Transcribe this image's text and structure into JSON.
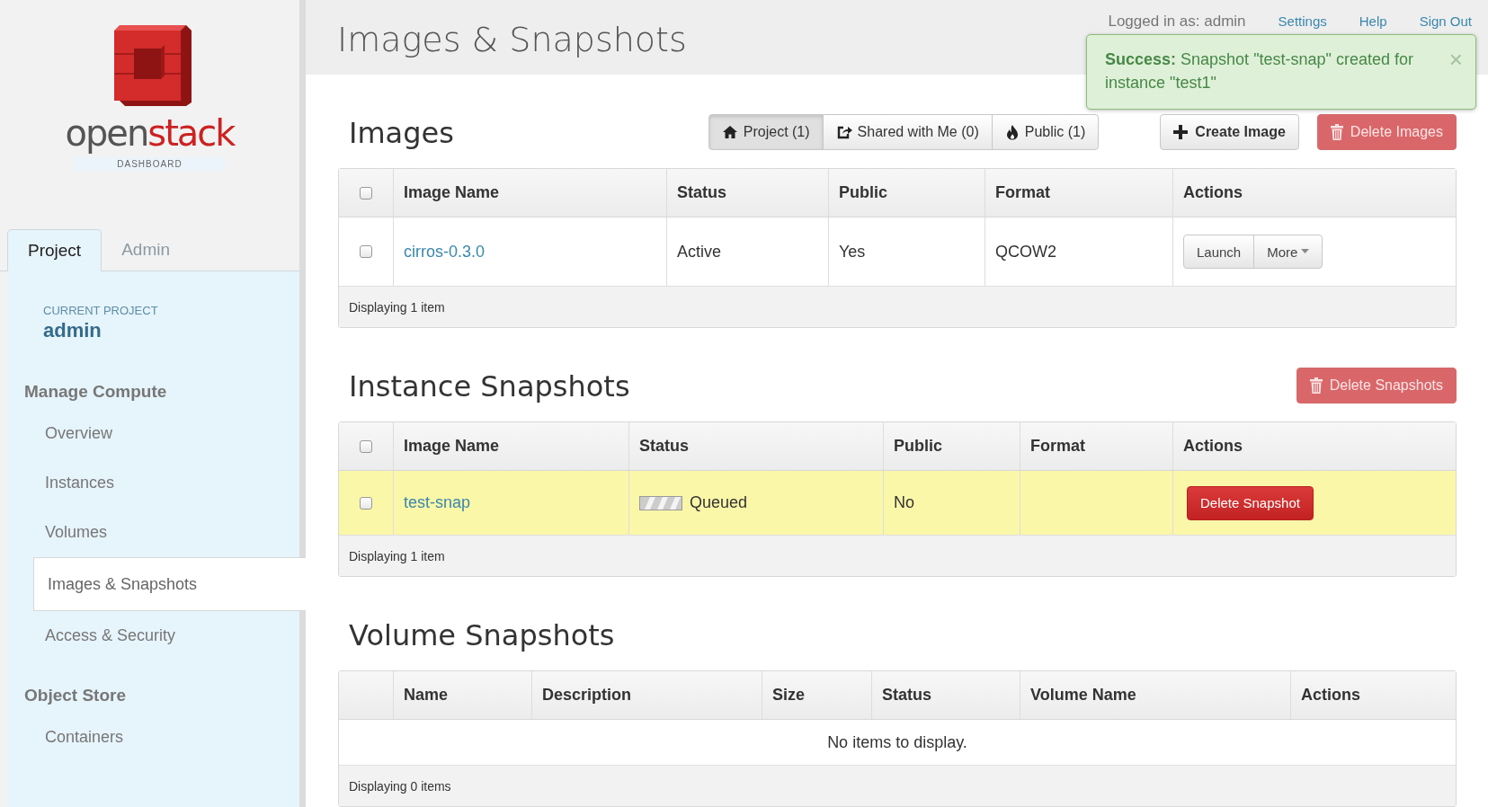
{
  "sidebar": {
    "logo": {
      "word_left": "open",
      "word_right": "stack",
      "subtitle": "DASHBOARD"
    },
    "tabs": [
      {
        "label": "Project",
        "selected": true
      },
      {
        "label": "Admin",
        "selected": false
      }
    ],
    "current_project": {
      "label": "CURRENT PROJECT",
      "name": "admin"
    },
    "groups": [
      {
        "title": "Manage Compute",
        "items": [
          {
            "label": "Overview",
            "selected": false
          },
          {
            "label": "Instances",
            "selected": false
          },
          {
            "label": "Volumes",
            "selected": false
          },
          {
            "label": "Images & Snapshots",
            "selected": true
          },
          {
            "label": "Access & Security",
            "selected": false
          }
        ]
      },
      {
        "title": "Object Store",
        "items": [
          {
            "label": "Containers",
            "selected": false
          }
        ]
      }
    ]
  },
  "header": {
    "title": "Images & Snapshots",
    "user": "Logged in as: admin",
    "links": [
      "Settings",
      "Help",
      "Sign Out"
    ]
  },
  "alert": {
    "message": "**Success:** Snapshot \"test-snap\" created for instance \"test1\"",
    "close": "×"
  },
  "sections": [
    {
      "title": "Images",
      "filters": [
        {
          "label": "Project (1)",
          "selected": true
        },
        {
          "label": "Shared with Me (0)",
          "selected": false
        },
        {
          "label": "Public (1)",
          "selected": false
        }
      ],
      "buttons": [
        {
          "label": "Create Image",
          "kind": "default"
        },
        {
          "label": "Delete Images",
          "kind": "danger"
        }
      ],
      "table": {
        "select_all": {
          "checked": false
        },
        "columns": [
          "Image Name",
          "Status",
          "Public",
          "Format",
          "Actions"
        ],
        "rows": [
          {
            "checked": false,
            "highlighted": false,
            "cells": [
              {
                "kind": "link",
                "text": "cirros-0.3.0"
              },
              {
                "kind": "text",
                "text": "Active"
              },
              {
                "kind": "text",
                "text": "Yes"
              },
              {
                "kind": "text",
                "text": "QCOW2"
              },
              {
                "kind": "button_group",
                "buttons": [
                  "Launch",
                  "More"
                ]
              }
            ]
          }
        ],
        "footer": "Displaying 1 item"
      }
    },
    {
      "title": "Instance Snapshots",
      "buttons": [
        {
          "label": "Delete Snapshots",
          "kind": "danger"
        }
      ],
      "table": {
        "select_all": {
          "checked": false
        },
        "columns": [
          "Image Name",
          "Status",
          "Public",
          "Format",
          "Actions"
        ],
        "rows": [
          {
            "checked": false,
            "highlighted": true,
            "cells": [
              {
                "kind": "link",
                "text": "test-snap"
              },
              {
                "kind": "pending",
                "text": "Queued"
              },
              {
                "kind": "text",
                "text": "No"
              },
              {
                "kind": "empty"
              },
              {
                "kind": "danger_button",
                "text": "Delete Snapshot"
              }
            ]
          }
        ],
        "footer": "Displaying 1 item"
      }
    },
    {
      "title": "Volume Snapshots",
      "table": {
        "columns": [
          "Name",
          "Description",
          "Size",
          "Status",
          "Volume Name",
          "Actions"
        ],
        "empty_message": "No items to display.",
        "footer": "Displaying 0 items"
      }
    }
  ]
}
